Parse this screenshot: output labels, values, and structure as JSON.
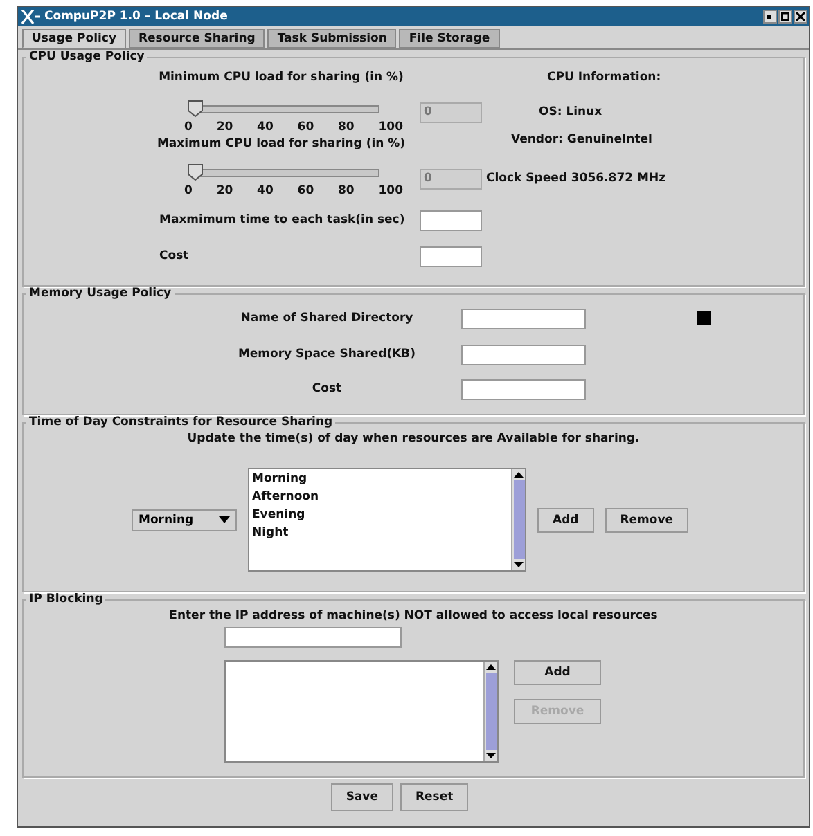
{
  "window": {
    "title": "CompuP2P 1.0 – Local Node"
  },
  "tabs": [
    {
      "label": "Usage Policy",
      "selected": true
    },
    {
      "label": "Resource Sharing",
      "selected": false
    },
    {
      "label": "Task Submission",
      "selected": false
    },
    {
      "label": "File Storage",
      "selected": false
    }
  ],
  "cpu_usage_policy": {
    "title": "CPU Usage Policy",
    "sliders": [
      {
        "label": "Minimum CPU load for sharing (in %)",
        "level": 0,
        "ticks": [
          "0",
          "20",
          "40",
          "60",
          "80",
          "100"
        ],
        "value": "0",
        "disabled": true
      },
      {
        "label": "Maximum CPU load for sharing (in %)",
        "level": 0,
        "ticks": [
          "0",
          "20",
          "40",
          "60",
          "80",
          "100"
        ],
        "value": "0",
        "disabled": true
      }
    ],
    "fields": [
      {
        "label": "Maxmimum time to each task(in sec)"
      },
      {
        "label": "Cost"
      }
    ],
    "cpu_info": {
      "heading": "CPU Information:",
      "os": "OS: Linux",
      "vendor": "Vendor: GenuineIntel",
      "clock_speed": "Clock Speed 3056.872 MHz"
    }
  },
  "memory_usage_policy": {
    "title": "Memory Usage Policy",
    "fields": [
      {
        "label": "Name of Shared Directory"
      },
      {
        "label": "Memory Space Shared(KB)"
      },
      {
        "label": "Cost"
      }
    ]
  },
  "time_constraints": {
    "title": "Time of Day Constraints for Resource Sharing",
    "instruction": "Update the time(s) of day when resources are Available for sharing.",
    "dropdown": {
      "value": "Morning"
    },
    "list": [
      "Morning",
      "Afternoon",
      "Evening",
      "Night"
    ],
    "buttons": [
      {
        "label": "Add",
        "disabled": false
      },
      {
        "label": "Remove",
        "disabled": false
      }
    ]
  },
  "ip_blocking": {
    "title": "IP Blocking",
    "instruction": "Enter the IP address of machine(s) NOT allowed to access local resources",
    "buttons": [
      {
        "label": "Add",
        "disabled": false
      },
      {
        "label": "Remove",
        "disabled": true
      }
    ]
  },
  "footer_buttons": [
    "Save",
    "Reset"
  ]
}
